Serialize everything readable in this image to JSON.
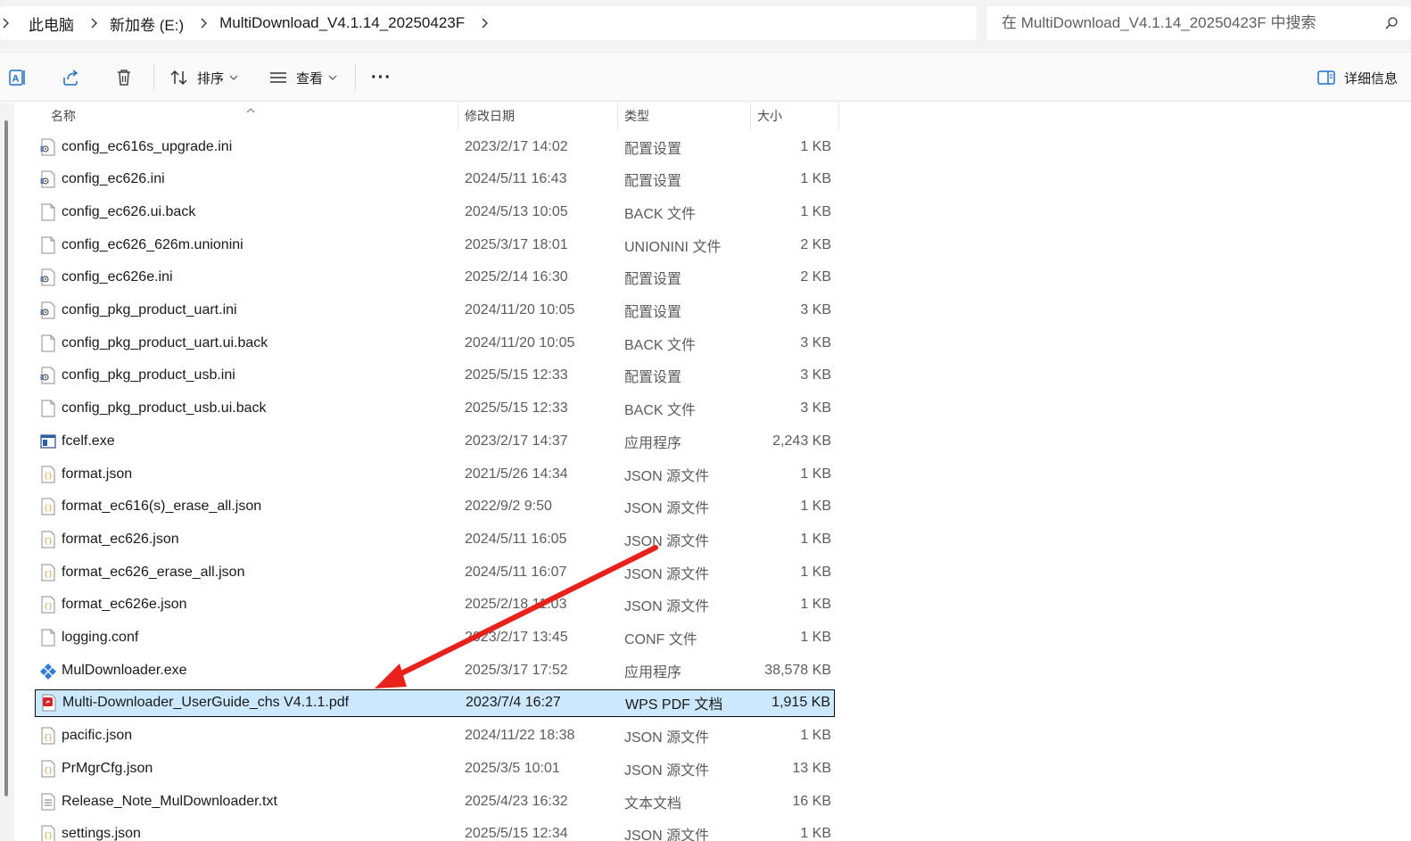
{
  "address": {
    "crumbs": [
      "此电脑",
      "新加卷 (E:)",
      "MultiDownload_V4.1.14_20250423F"
    ],
    "search_placeholder": "在 MultiDownload_V4.1.14_20250423F 中搜索"
  },
  "toolbar": {
    "sort_label": "排序",
    "view_label": "查看",
    "more_label": "···",
    "details_label": "详细信息"
  },
  "columns": {
    "name": "名称",
    "date": "修改日期",
    "type": "类型",
    "size": "大小"
  },
  "files": [
    {
      "name": "config_ec616s_upgrade.ini",
      "date": "2023/2/17 14:02",
      "type": "配置设置",
      "size": "1 KB",
      "icon": "ini-settings-icon"
    },
    {
      "name": "config_ec626.ini",
      "date": "2024/5/11 16:43",
      "type": "配置设置",
      "size": "1 KB",
      "icon": "ini-settings-icon"
    },
    {
      "name": "config_ec626.ui.back",
      "date": "2024/5/13 10:05",
      "type": "BACK 文件",
      "size": "1 KB",
      "icon": "blank-file-icon"
    },
    {
      "name": "config_ec626_626m.unionini",
      "date": "2025/3/17 18:01",
      "type": "UNIONINI 文件",
      "size": "2 KB",
      "icon": "blank-file-icon"
    },
    {
      "name": "config_ec626e.ini",
      "date": "2025/2/14 16:30",
      "type": "配置设置",
      "size": "2 KB",
      "icon": "ini-settings-icon"
    },
    {
      "name": "config_pkg_product_uart.ini",
      "date": "2024/11/20 10:05",
      "type": "配置设置",
      "size": "3 KB",
      "icon": "ini-settings-icon"
    },
    {
      "name": "config_pkg_product_uart.ui.back",
      "date": "2024/11/20 10:05",
      "type": "BACK 文件",
      "size": "3 KB",
      "icon": "blank-file-icon"
    },
    {
      "name": "config_pkg_product_usb.ini",
      "date": "2025/5/15 12:33",
      "type": "配置设置",
      "size": "3 KB",
      "icon": "ini-settings-icon"
    },
    {
      "name": "config_pkg_product_usb.ui.back",
      "date": "2025/5/15 12:33",
      "type": "BACK 文件",
      "size": "3 KB",
      "icon": "blank-file-icon"
    },
    {
      "name": "fcelf.exe",
      "date": "2023/2/17 14:37",
      "type": "应用程序",
      "size": "2,243 KB",
      "icon": "exe-window-icon"
    },
    {
      "name": "format.json",
      "date": "2021/5/26 14:34",
      "type": "JSON 源文件",
      "size": "1 KB",
      "icon": "json-file-icon"
    },
    {
      "name": "format_ec616(s)_erase_all.json",
      "date": "2022/9/2 9:50",
      "type": "JSON 源文件",
      "size": "1 KB",
      "icon": "json-file-icon"
    },
    {
      "name": "format_ec626.json",
      "date": "2024/5/11 16:05",
      "type": "JSON 源文件",
      "size": "1 KB",
      "icon": "json-file-icon"
    },
    {
      "name": "format_ec626_erase_all.json",
      "date": "2024/5/11 16:07",
      "type": "JSON 源文件",
      "size": "1 KB",
      "icon": "json-file-icon"
    },
    {
      "name": "format_ec626e.json",
      "date": "2025/2/18 11:03",
      "type": "JSON 源文件",
      "size": "1 KB",
      "icon": "json-file-icon"
    },
    {
      "name": "logging.conf",
      "date": "2023/2/17 13:45",
      "type": "CONF 文件",
      "size": "1 KB",
      "icon": "blank-file-icon"
    },
    {
      "name": "MulDownloader.exe",
      "date": "2025/3/17 17:52",
      "type": "应用程序",
      "size": "38,578 KB",
      "icon": "app-diamond-icon"
    },
    {
      "name": "Multi-Downloader_UserGuide_chs V4.1.1.pdf",
      "date": "2023/7/4 16:27",
      "type": "WPS PDF 文档",
      "size": "1,915 KB",
      "icon": "pdf-file-icon",
      "selected": true
    },
    {
      "name": "pacific.json",
      "date": "2024/11/22 18:38",
      "type": "JSON 源文件",
      "size": "1 KB",
      "icon": "json-file-icon"
    },
    {
      "name": "PrMgrCfg.json",
      "date": "2025/3/5 10:01",
      "type": "JSON 源文件",
      "size": "13 KB",
      "icon": "json-file-icon"
    },
    {
      "name": "Release_Note_MulDownloader.txt",
      "date": "2025/4/23 16:32",
      "type": "文本文档",
      "size": "16 KB",
      "icon": "text-file-icon"
    },
    {
      "name": "settings.json",
      "date": "2025/5/15 12:34",
      "type": "JSON 源文件",
      "size": "1 KB",
      "icon": "json-file-icon"
    }
  ],
  "colors": {
    "selection": "#cce8ff",
    "annotation_arrow": "#e8211b"
  }
}
